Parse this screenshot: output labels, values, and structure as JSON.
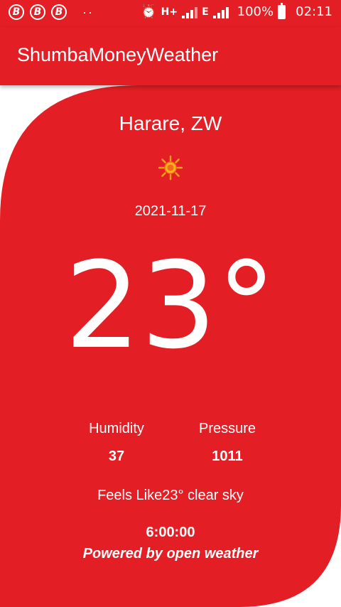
{
  "status_bar": {
    "time": "02:11",
    "battery": "100%",
    "network_1": "H+",
    "network_2": "E",
    "left_icons": [
      "b-icon",
      "b-icon",
      "b-icon"
    ]
  },
  "app_bar": {
    "title": "ShumbaMoneyWeather"
  },
  "weather": {
    "city": "Harare, ZW",
    "icon": "sun-icon",
    "date": "2021-11-17",
    "temperature": "23°",
    "humidity_label": "Humidity",
    "humidity_value": "37",
    "pressure_label": "Pressure",
    "pressure_value": "1011",
    "feels_like": "Feels Like23° clear sky",
    "time": "6:00:00",
    "powered_by": "Powered by open weather"
  },
  "colors": {
    "primary": "#e31e24",
    "background": "#ffffff",
    "text": "#ffffff"
  }
}
